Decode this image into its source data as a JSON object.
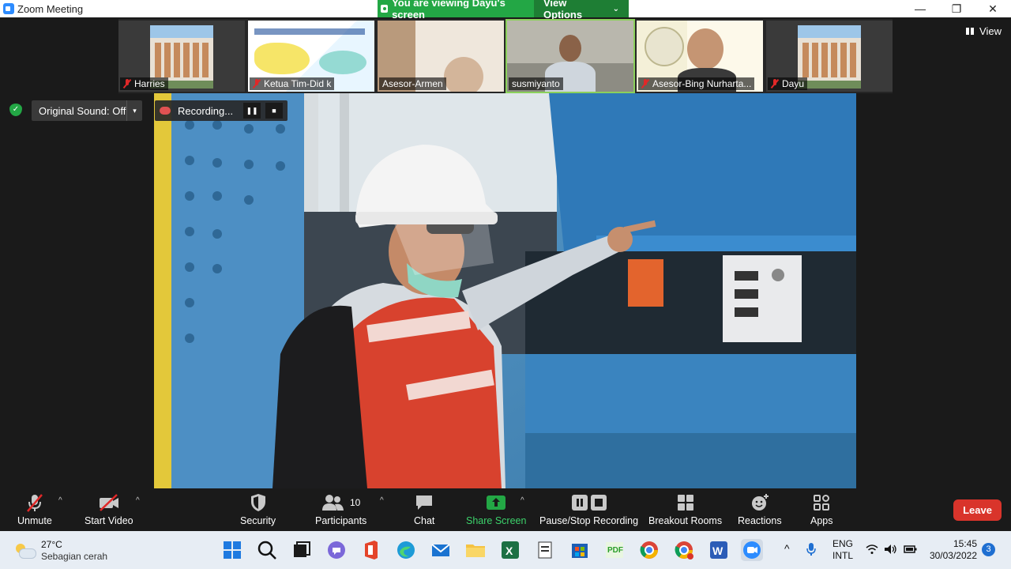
{
  "window": {
    "title": "Zoom Meeting"
  },
  "banner": {
    "viewing_text": "You are viewing Dayu's screen",
    "options_label": "View Options"
  },
  "window_controls": {
    "minimize": "—",
    "maximize": "❐",
    "close": "✕"
  },
  "participants_strip": [
    {
      "name": "Harries",
      "muted": true,
      "active": false
    },
    {
      "name": "Ketua Tim-Did k",
      "muted": true,
      "active": false
    },
    {
      "name": "Asesor-Armen",
      "muted": false,
      "active": false
    },
    {
      "name": "susmiyanto",
      "muted": false,
      "active": true
    },
    {
      "name": "Asesor-Bing Nurharta...",
      "muted": true,
      "active": false
    },
    {
      "name": "Dayu",
      "muted": true,
      "active": false
    }
  ],
  "view_button": {
    "label": "View"
  },
  "audio": {
    "original_sound_label": "Original Sound: Off",
    "caret": "▾"
  },
  "recording": {
    "status_label": "Recording...",
    "pause_icon": "❚❚",
    "stop_icon": "■"
  },
  "toolbar": {
    "unmute": "Unmute",
    "start_video": "Start Video",
    "security": "Security",
    "participants": "Participants",
    "participants_count": "10",
    "chat": "Chat",
    "share_screen": "Share Screen",
    "pause_stop_recording": "Pause/Stop Recording",
    "breakout_rooms": "Breakout Rooms",
    "reactions": "Reactions",
    "apps": "Apps",
    "leave": "Leave",
    "caret": "^"
  },
  "taskbar": {
    "weather_temp": "27°C",
    "weather_desc": "Sebagian cerah",
    "lang_top": "ENG",
    "lang_bottom": "INTL",
    "time": "15:45",
    "date": "30/03/2022",
    "notifications": "3",
    "tray_chevron": "^"
  },
  "colors": {
    "zoom_blue": "#2d8cff",
    "share_green": "#23a745",
    "leave_red": "#d9342b",
    "toolbar_bg": "#1a1a1a",
    "taskbar_bg": "#e7edf4"
  }
}
